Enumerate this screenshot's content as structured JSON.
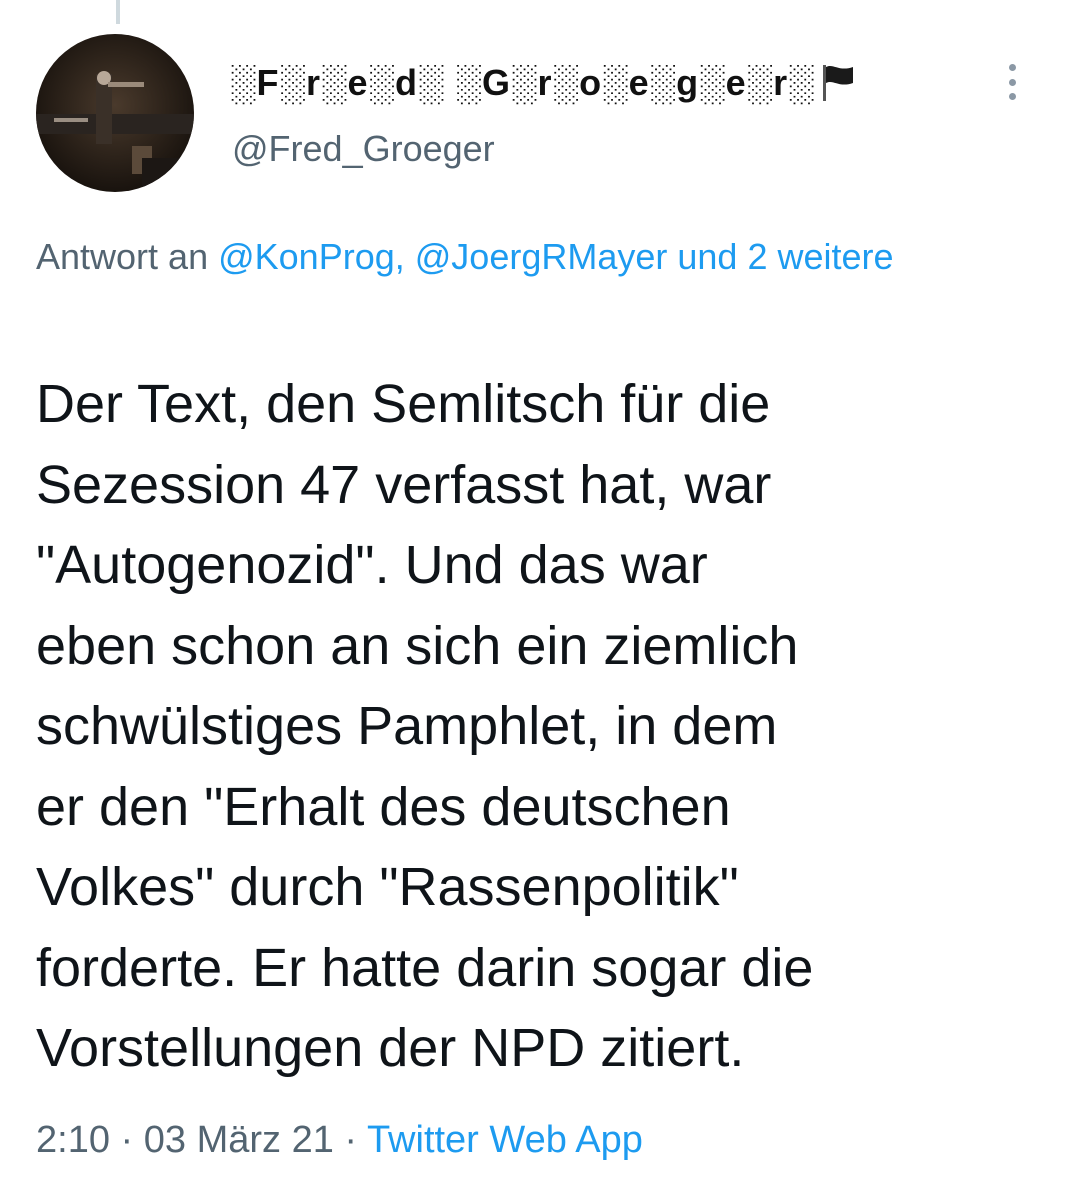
{
  "tweet": {
    "display_name": "░F░r░e░d░ ░G░r░o░e░g░e░r░",
    "display_name_emoji": "black-flag-icon",
    "handle": "@Fred_Groeger",
    "reply_prefix": "Antwort an ",
    "reply_to_1": "@KonProg",
    "reply_sep": ", ",
    "reply_to_2": "@JoergRMayer",
    "reply_suffix": " und 2 weitere",
    "text": "Der Text, den Semlitsch für die\nSezession 47 verfasst hat, war\n\"Autogenozid\". Und das war\neben schon an sich ein ziemlich\nschwülstiges Pamphlet, in dem\ner den \"Erhalt des deutschen\nVolkes\" durch \"Rassenpolitik\"\nforderte. Er hatte darin sogar die\nVorstellungen der NPD zitiert.",
    "time": "2:10",
    "dot": " · ",
    "date": "03 März 21",
    "source": "Twitter Web App"
  },
  "colors": {
    "text": "#0f1419",
    "secondary": "#536471",
    "link": "#1d9bf0"
  }
}
